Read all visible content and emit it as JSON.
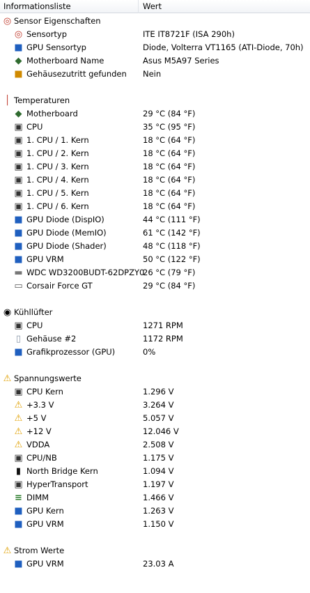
{
  "columns": {
    "name": "Informationsliste",
    "value": "Wert"
  },
  "groups": [
    {
      "title": "Sensor Eigenschaften",
      "icon": "gauge-icon",
      "items": [
        {
          "label": "Sensortyp",
          "value": "ITE IT8721F  (ISA 290h)",
          "icon": "gauge-icon"
        },
        {
          "label": "GPU Sensortyp",
          "value": "Diode, Volterra VT1165  (ATI-Diode, 70h)",
          "icon": "monitor-icon"
        },
        {
          "label": "Motherboard Name",
          "value": "Asus M5A97 Series",
          "icon": "motherboard-icon"
        },
        {
          "label": "Gehäusezutritt gefunden",
          "value": "Nein",
          "icon": "lock-icon"
        }
      ]
    },
    {
      "title": "Temperaturen",
      "icon": "thermometer-icon",
      "items": [
        {
          "label": "Motherboard",
          "value": "29 °C  (84 °F)",
          "icon": "motherboard-icon"
        },
        {
          "label": "CPU",
          "value": "35 °C  (95 °F)",
          "icon": "cpu-chip-icon"
        },
        {
          "label": "1. CPU / 1. Kern",
          "value": "18 °C  (64 °F)",
          "icon": "cpu-chip-icon"
        },
        {
          "label": "1. CPU / 2. Kern",
          "value": "18 °C  (64 °F)",
          "icon": "cpu-chip-icon"
        },
        {
          "label": "1. CPU / 3. Kern",
          "value": "18 °C  (64 °F)",
          "icon": "cpu-chip-icon"
        },
        {
          "label": "1. CPU / 4. Kern",
          "value": "18 °C  (64 °F)",
          "icon": "cpu-chip-icon"
        },
        {
          "label": "1. CPU / 5. Kern",
          "value": "18 °C  (64 °F)",
          "icon": "cpu-chip-icon"
        },
        {
          "label": "1. CPU / 6. Kern",
          "value": "18 °C  (64 °F)",
          "icon": "cpu-chip-icon"
        },
        {
          "label": "GPU Diode (DispIO)",
          "value": "44 °C  (111 °F)",
          "icon": "monitor-icon"
        },
        {
          "label": "GPU Diode (MemIO)",
          "value": "61 °C  (142 °F)",
          "icon": "monitor-icon"
        },
        {
          "label": "GPU Diode (Shader)",
          "value": "48 °C  (118 °F)",
          "icon": "monitor-icon"
        },
        {
          "label": "GPU VRM",
          "value": "50 °C  (122 °F)",
          "icon": "monitor-icon"
        },
        {
          "label": "WDC WD3200BUDT-62DPZY0",
          "value": "26 °C  (79 °F)",
          "icon": "hard-disk-icon"
        },
        {
          "label": "Corsair Force GT",
          "value": "29 °C  (84 °F)",
          "icon": "ssd-icon"
        }
      ]
    },
    {
      "title": "Kühllüfter",
      "icon": "fan-icon",
      "items": [
        {
          "label": "CPU",
          "value": "1271 RPM",
          "icon": "cpu-chip-icon"
        },
        {
          "label": "Gehäuse #2",
          "value": "1172 RPM",
          "icon": "case-icon"
        },
        {
          "label": "Grafikprozessor (GPU)",
          "value": "0%",
          "icon": "monitor-icon"
        }
      ]
    },
    {
      "title": "Spannungswerte",
      "icon": "warning-icon",
      "items": [
        {
          "label": "CPU Kern",
          "value": "1.296 V",
          "icon": "cpu-chip-icon"
        },
        {
          "label": "+3.3 V",
          "value": "3.264 V",
          "icon": "warning-icon"
        },
        {
          "label": "+5 V",
          "value": "5.057 V",
          "icon": "warning-icon"
        },
        {
          "label": "+12 V",
          "value": "12.046 V",
          "icon": "warning-icon"
        },
        {
          "label": "VDDA",
          "value": "2.508 V",
          "icon": "warning-icon"
        },
        {
          "label": "CPU/NB",
          "value": "1.175 V",
          "icon": "cpu-chip-icon"
        },
        {
          "label": "North Bridge Kern",
          "value": "1.094 V",
          "icon": "north-bridge-icon"
        },
        {
          "label": "HyperTransport",
          "value": "1.197 V",
          "icon": "cpu-chip-icon"
        },
        {
          "label": "DIMM",
          "value": "1.466 V",
          "icon": "ram-icon"
        },
        {
          "label": "GPU Kern",
          "value": "1.263 V",
          "icon": "monitor-icon"
        },
        {
          "label": "GPU VRM",
          "value": "1.150 V",
          "icon": "monitor-icon"
        }
      ]
    },
    {
      "title": "Strom Werte",
      "icon": "warning-icon",
      "items": [
        {
          "label": "GPU VRM",
          "value": "23.03 A",
          "icon": "monitor-icon"
        }
      ]
    }
  ]
}
